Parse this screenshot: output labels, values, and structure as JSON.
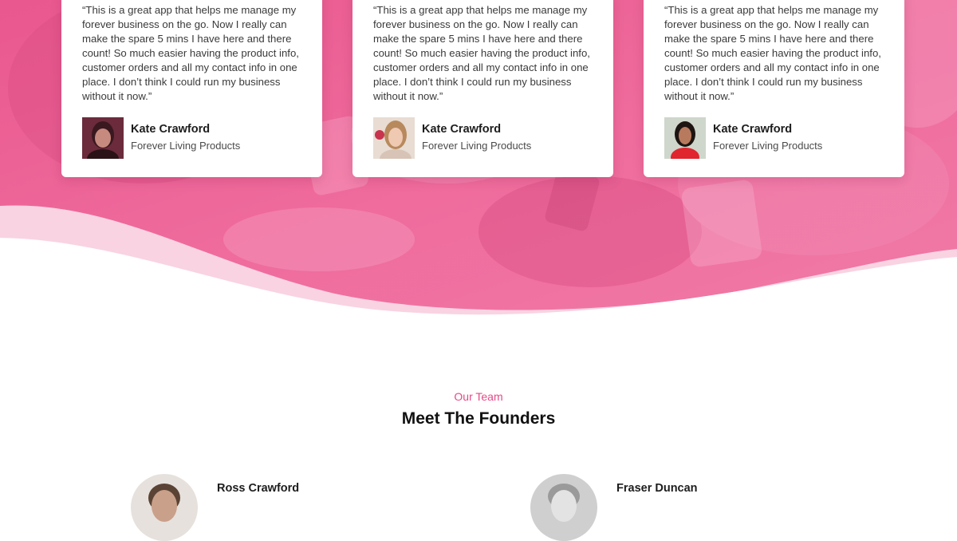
{
  "testimonials": [
    {
      "quote": "“This is a great app that helps me manage my forever business on the go. Now I really can make the spare 5 mins I have here and there count! So much easier having the product info, customer orders and all my contact info in one place. I don’t think I could run my business without it now.”",
      "name": "Kate Crawford",
      "company": "Forever Living Products",
      "avatar_icon": "person-avatar-icon"
    },
    {
      "quote": "“This is a great app that helps me manage my forever business on the go. Now I really can make the spare 5 mins I have here and there count! So much easier having the product info, customer orders and all my contact info in one place. I don’t think I could run my business without it now.”",
      "name": "Kate Crawford",
      "company": "Forever Living Products",
      "avatar_icon": "person-avatar-icon"
    },
    {
      "quote": "“This is a great app that helps me manage my forever business on the go. Now I really can make the spare 5 mins I have here and there count! So much easier having the product info, customer orders and all my contact info in one place. I don’t think I could run my business without it now.”",
      "name": "Kate Crawford",
      "company": "Forever Living Products",
      "avatar_icon": "person-avatar-icon"
    }
  ],
  "team": {
    "eyebrow": "Our Team",
    "title": "Meet The Founders",
    "founders": [
      {
        "name": "Ross Crawford"
      },
      {
        "name": "Fraser Duncan"
      }
    ]
  },
  "colors": {
    "accent": "#e44a87",
    "hero_pink": "#ec5d93",
    "wave_light": "#f9d3e2"
  }
}
